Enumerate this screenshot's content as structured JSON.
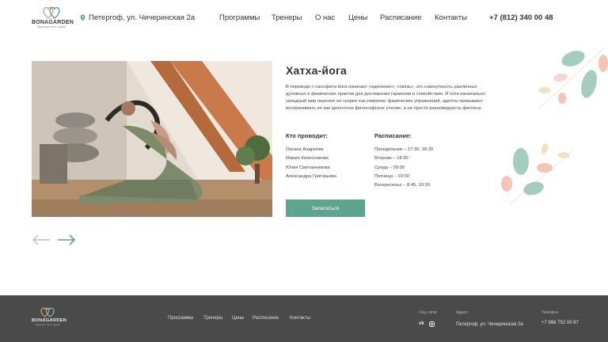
{
  "brand": {
    "name": "BONAGARDEN",
    "tagline": "Гармония тела и души"
  },
  "header": {
    "address": "Петергоф, ул. Чичеринская 2а",
    "nav": [
      "Программы",
      "Тренеры",
      "О нас",
      "Цены",
      "Расписание",
      "Контакты"
    ],
    "phone": "+7 (812) 340 00 48"
  },
  "main": {
    "title": "Хатха-йога",
    "description": "В переводе с санскрита йога означает «единение», «связь», это совокупность различных духовных и физических практик для достижения гармонии и спокойствия. И хотя изначально западный мир перенял ее скорее как комплекс физических упражнений, адепты призывают воспринимать ее как целостное философское учение, а не просто разновидность фитнеса.",
    "trainers_heading": "Кто проводит:",
    "trainers": [
      "Оксана Андреева",
      "Мария Колесникова",
      "Юлия Сметанникова",
      "Александра Григорьева"
    ],
    "schedule_heading": "Расписание:",
    "schedule": [
      "Понедельник – 17:30, 18:30",
      "Вторник – 18:30",
      "Среда – 09:00",
      "Пятница – 19:00",
      "Воскресенье – 8:45, 10:30"
    ],
    "signup_label": "Записаться"
  },
  "footer": {
    "nav": [
      "Программы",
      "Тренеры",
      "Цены",
      "Расписание",
      "Контакты"
    ],
    "social_label": "Соц. сети:",
    "social": [
      "vk",
      "instagram"
    ],
    "address_label": "Адрес:",
    "address": "Петергоф, ул. Чичеринская 2а",
    "phone_label": "Телефон:",
    "phone": "+7 966 752 00 87"
  },
  "colors": {
    "accent": "#5ea48e",
    "footer_bg": "#4a4a4a",
    "leaf_green": "#9fc9b9",
    "leaf_pink": "#f3c2b5",
    "leaf_yellow": "#f1e2b9"
  }
}
